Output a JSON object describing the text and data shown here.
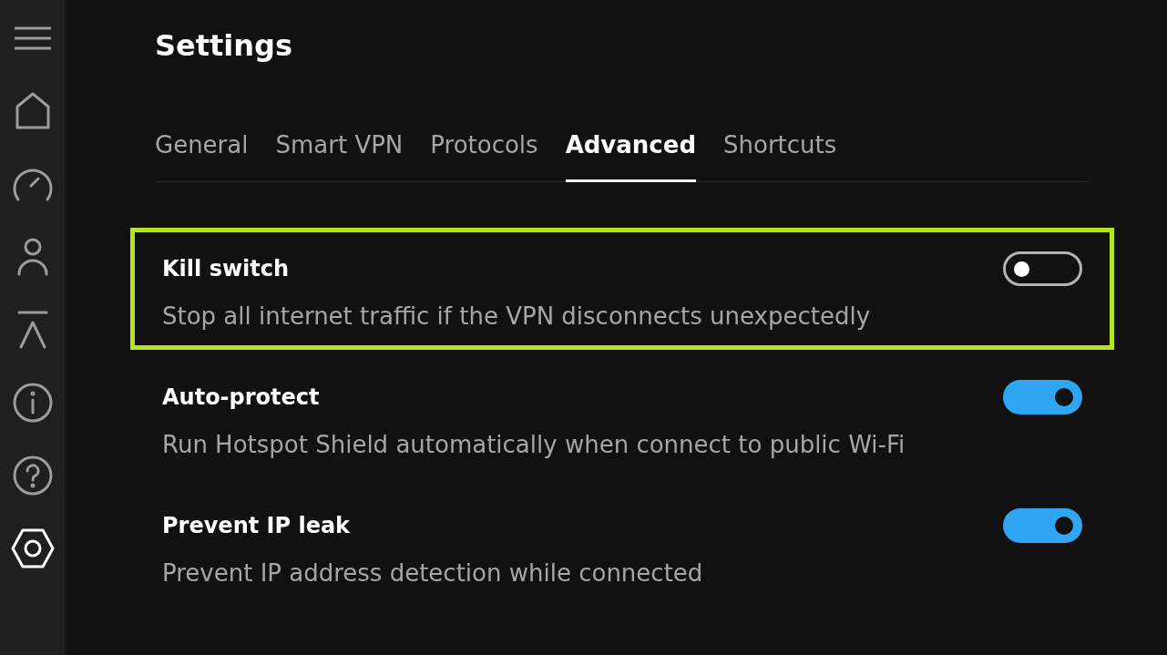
{
  "sidebar": {
    "items": [
      {
        "kind": "home",
        "selected": false
      },
      {
        "kind": "speed",
        "selected": false
      },
      {
        "kind": "account",
        "selected": false
      },
      {
        "kind": "upgrade",
        "selected": false
      },
      {
        "kind": "info",
        "selected": false
      },
      {
        "kind": "help",
        "selected": false
      },
      {
        "kind": "settings",
        "selected": true
      }
    ]
  },
  "title": "Settings",
  "tabs": [
    {
      "label": "General",
      "selected": false
    },
    {
      "label": "Smart VPN",
      "selected": false
    },
    {
      "label": "Protocols",
      "selected": false
    },
    {
      "label": "Advanced",
      "selected": true
    },
    {
      "label": "Shortcuts",
      "selected": false
    }
  ],
  "settings": [
    {
      "title": "Kill switch",
      "description": "Stop all internet traffic if the VPN disconnects unexpectedly",
      "on": false,
      "highlighted": true
    },
    {
      "title": "Auto-protect",
      "description": "Run Hotspot Shield automatically when connect to public Wi-Fi",
      "on": true,
      "highlighted": false
    },
    {
      "title": "Prevent IP leak",
      "description": "Prevent IP address detection while connected",
      "on": true,
      "highlighted": false
    }
  ]
}
